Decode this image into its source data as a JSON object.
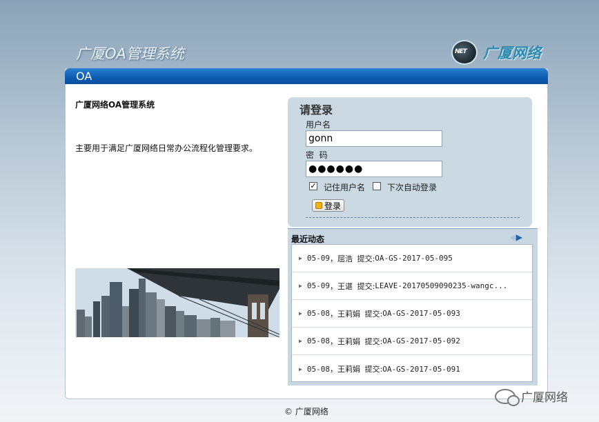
{
  "header": {
    "system_title": "广厦OA管理系统",
    "brand_icon_text": "NET",
    "brand_name": "广厦网络"
  },
  "panel": {
    "bar_title": "OA",
    "desc_title": "广厦网络OA管理系统",
    "desc_text": "主要用于满足广厦网络日常办公流程化管理要求。"
  },
  "login": {
    "title": "请登录",
    "username_label": "用户名",
    "username_value": "gonn",
    "password_label": "密  码",
    "password_value": "●●●●●●",
    "remember_label": "记住用户名",
    "remember_checked": true,
    "auto_login_label": "下次自动登录",
    "auto_login_checked": false,
    "button_label": "登录"
  },
  "news": {
    "title": "最近动态",
    "items": [
      {
        "date": "05-09",
        "name": "屈浩",
        "action": "提交:",
        "code": "OA-GS-2017-05-095"
      },
      {
        "date": "05-09",
        "name": "王谌",
        "action": "提交:",
        "code": "LEAVE-20170509090235-wangc..."
      },
      {
        "date": "05-08",
        "name": "王莉娟",
        "action": "提交:",
        "code": "OA-GS-2017-05-093"
      },
      {
        "date": "05-08",
        "name": "王莉娟",
        "action": "提交:",
        "code": "OA-GS-2017-05-092"
      },
      {
        "date": "05-08",
        "name": "王莉娟",
        "action": "提交:",
        "code": "OA-GS-2017-05-091"
      }
    ]
  },
  "footer": {
    "copyright": "© 广厦网络"
  },
  "watermark": {
    "text": "广厦网络"
  }
}
